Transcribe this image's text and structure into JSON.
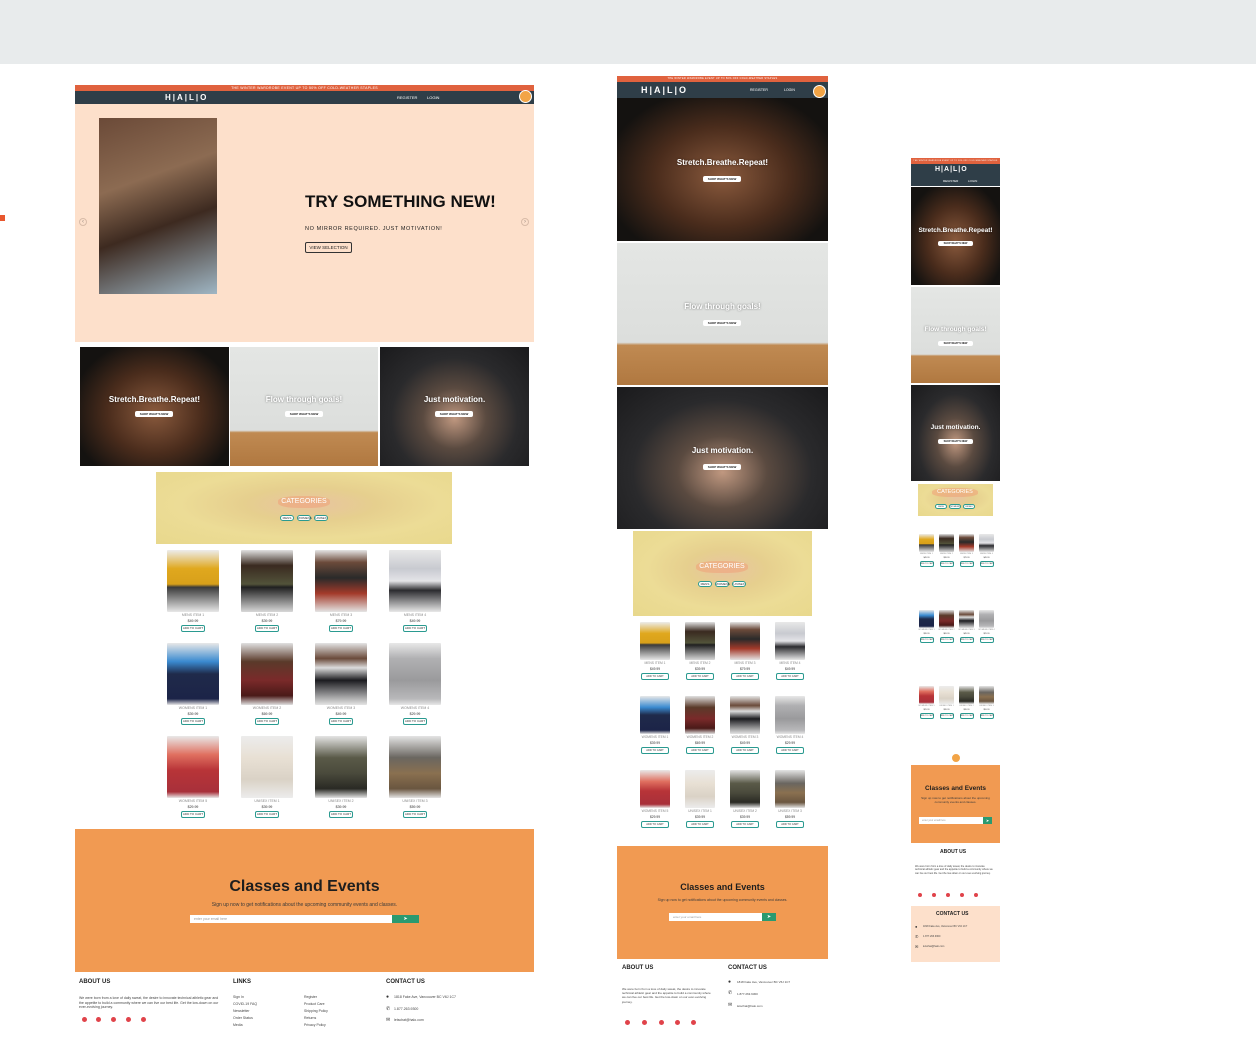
{
  "promo_text": "THE WINTER WARDROBE EVENT UP TO 50% OFF COLD-WEATHER STAPLES",
  "logo": "H|A|L|O",
  "nav": {
    "register": "REGISTER",
    "login": "LOGIN"
  },
  "hero": {
    "title": "TRY SOMETHING NEW!",
    "subtitle": "NO MIRROR REQUIRED. JUST MOTIVATION!",
    "button": "VIEW SELECTION",
    "prev": "‹",
    "next": "›"
  },
  "tiles": [
    {
      "title": "Stretch.Breathe.Repeat!",
      "button": "SHOP WHAT'S NEW"
    },
    {
      "title": "Flow through goals!",
      "button": "SHOP WHAT'S NEW"
    },
    {
      "title": "Just motivation.",
      "button": "SHOP WHAT'S NEW"
    }
  ],
  "categories": {
    "title": "CATEGORIES",
    "pills": [
      "MENS",
      "WOMENS",
      "UNISEX"
    ]
  },
  "products": [
    {
      "name": "MENS ITEM 1",
      "price": "$49.99",
      "button": "ADD TO CART"
    },
    {
      "name": "MENS ITEM 2",
      "price": "$39.99",
      "button": "ADD TO CART"
    },
    {
      "name": "MENS ITEM 3",
      "price": "$79.99",
      "button": "ADD TO CART"
    },
    {
      "name": "MENS ITEM 4",
      "price": "$49.99",
      "button": "ADD TO CART"
    },
    {
      "name": "WOMENS ITEM 1",
      "price": "$39.99",
      "button": "ADD TO CART"
    },
    {
      "name": "WOMENS ITEM 2",
      "price": "$69.99",
      "button": "ADD TO CART"
    },
    {
      "name": "WOMENS ITEM 3",
      "price": "$49.99",
      "button": "ADD TO CART"
    },
    {
      "name": "WOMENS ITEM 4",
      "price": "$29.99",
      "button": "ADD TO CART"
    },
    {
      "name": "WOMENS ITEM 5",
      "price": "$29.99",
      "button": "ADD TO CART"
    },
    {
      "name": "UNISEX ITEM 1",
      "price": "$39.99",
      "button": "ADD TO CART"
    },
    {
      "name": "UNISEX ITEM 2",
      "price": "$39.99",
      "button": "ADD TO CART"
    },
    {
      "name": "UNISEX ITEM 3",
      "price": "$59.99",
      "button": "ADD TO CART"
    }
  ],
  "events": {
    "title": "Classes and Events",
    "subtitle": "Sign up now to get notifications about the upcoming community events and classes.",
    "placeholder": "enter your email here",
    "go": "➤"
  },
  "footer": {
    "about_h": "ABOUT US",
    "about_t": "We were born from a love of daily sweat, the desire to innovate technical athletic gear and the appetite to build a community where we can live our best life. Get the low-down on our ever-evolving journey.",
    "links_h": "LINKS",
    "links_col1": [
      "Sign In",
      "COVID-19 FAQ",
      "Newsletter",
      "Order Status",
      "Media"
    ],
    "links_col2": [
      "Register",
      "Product Care",
      "Shipping Policy",
      "Returns",
      "Privacy Policy"
    ],
    "contact_h": "CONTACT US",
    "address": "1818 Fake Ave, Vancouver BC V6J 1C7",
    "phone": "1.877.263.9300",
    "email": "letschat@halo.com"
  },
  "colors": {
    "promo": "#e0623e",
    "nav": "#2f3e48",
    "hero_bg": "#fde0cb",
    "events": "#f19a52",
    "teal": "#2a9a90",
    "social": "#e0434a"
  }
}
